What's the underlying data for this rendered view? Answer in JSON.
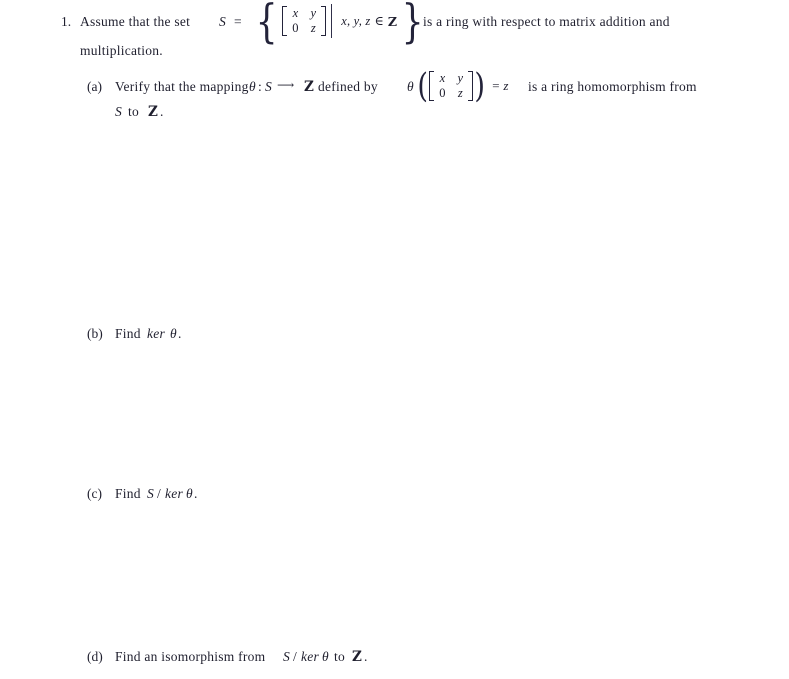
{
  "document": {
    "type": "math-worksheet",
    "background_color": "#ffffff",
    "text_color": "#1f1f2e"
  },
  "problem": {
    "number": "1.",
    "stem_part1": "Assume that the set",
    "set_symbol": "S",
    "equals": "=",
    "matrix": {
      "row1": [
        "x",
        "y"
      ],
      "row2": [
        "0",
        "z"
      ]
    },
    "separator": "|",
    "condition": "x, y, z",
    "condition_member": "∈",
    "condition_set": "Z",
    "stem_part2": "is a ring with respect to matrix addition and",
    "stem_part3": "multiplication."
  },
  "parts": [
    {
      "label": "(a)",
      "text_before": "Verify that the mapping",
      "theta": "θ",
      "colon": ":",
      "domain": "S",
      "arrow": "⟶",
      "codomain": "Z",
      "text_defined": "defined by",
      "map_theta": "θ",
      "matrix": {
        "row1": [
          "x",
          "y"
        ],
        "row2": [
          "0",
          "z"
        ]
      },
      "result": "= z",
      "text_after": "is a ring homomorphism from",
      "text_line2_pre": "S",
      "text_line2_mid": "to",
      "text_line2_set": "Z",
      "text_line2_end": "."
    },
    {
      "label": "(b)",
      "find": "Find",
      "ker": "ker",
      "theta": "θ",
      "period": "."
    },
    {
      "label": "(c)",
      "find": "Find",
      "quotient_num": "S",
      "slash": "/",
      "ker": "ker",
      "theta": "θ",
      "period": "."
    },
    {
      "label": "(d)",
      "find": "Find an isomorphism from",
      "quotient_num": "S",
      "slash": "/",
      "ker": "ker",
      "theta": "θ",
      "to": "to",
      "target_set": "Z",
      "period": "."
    }
  ]
}
